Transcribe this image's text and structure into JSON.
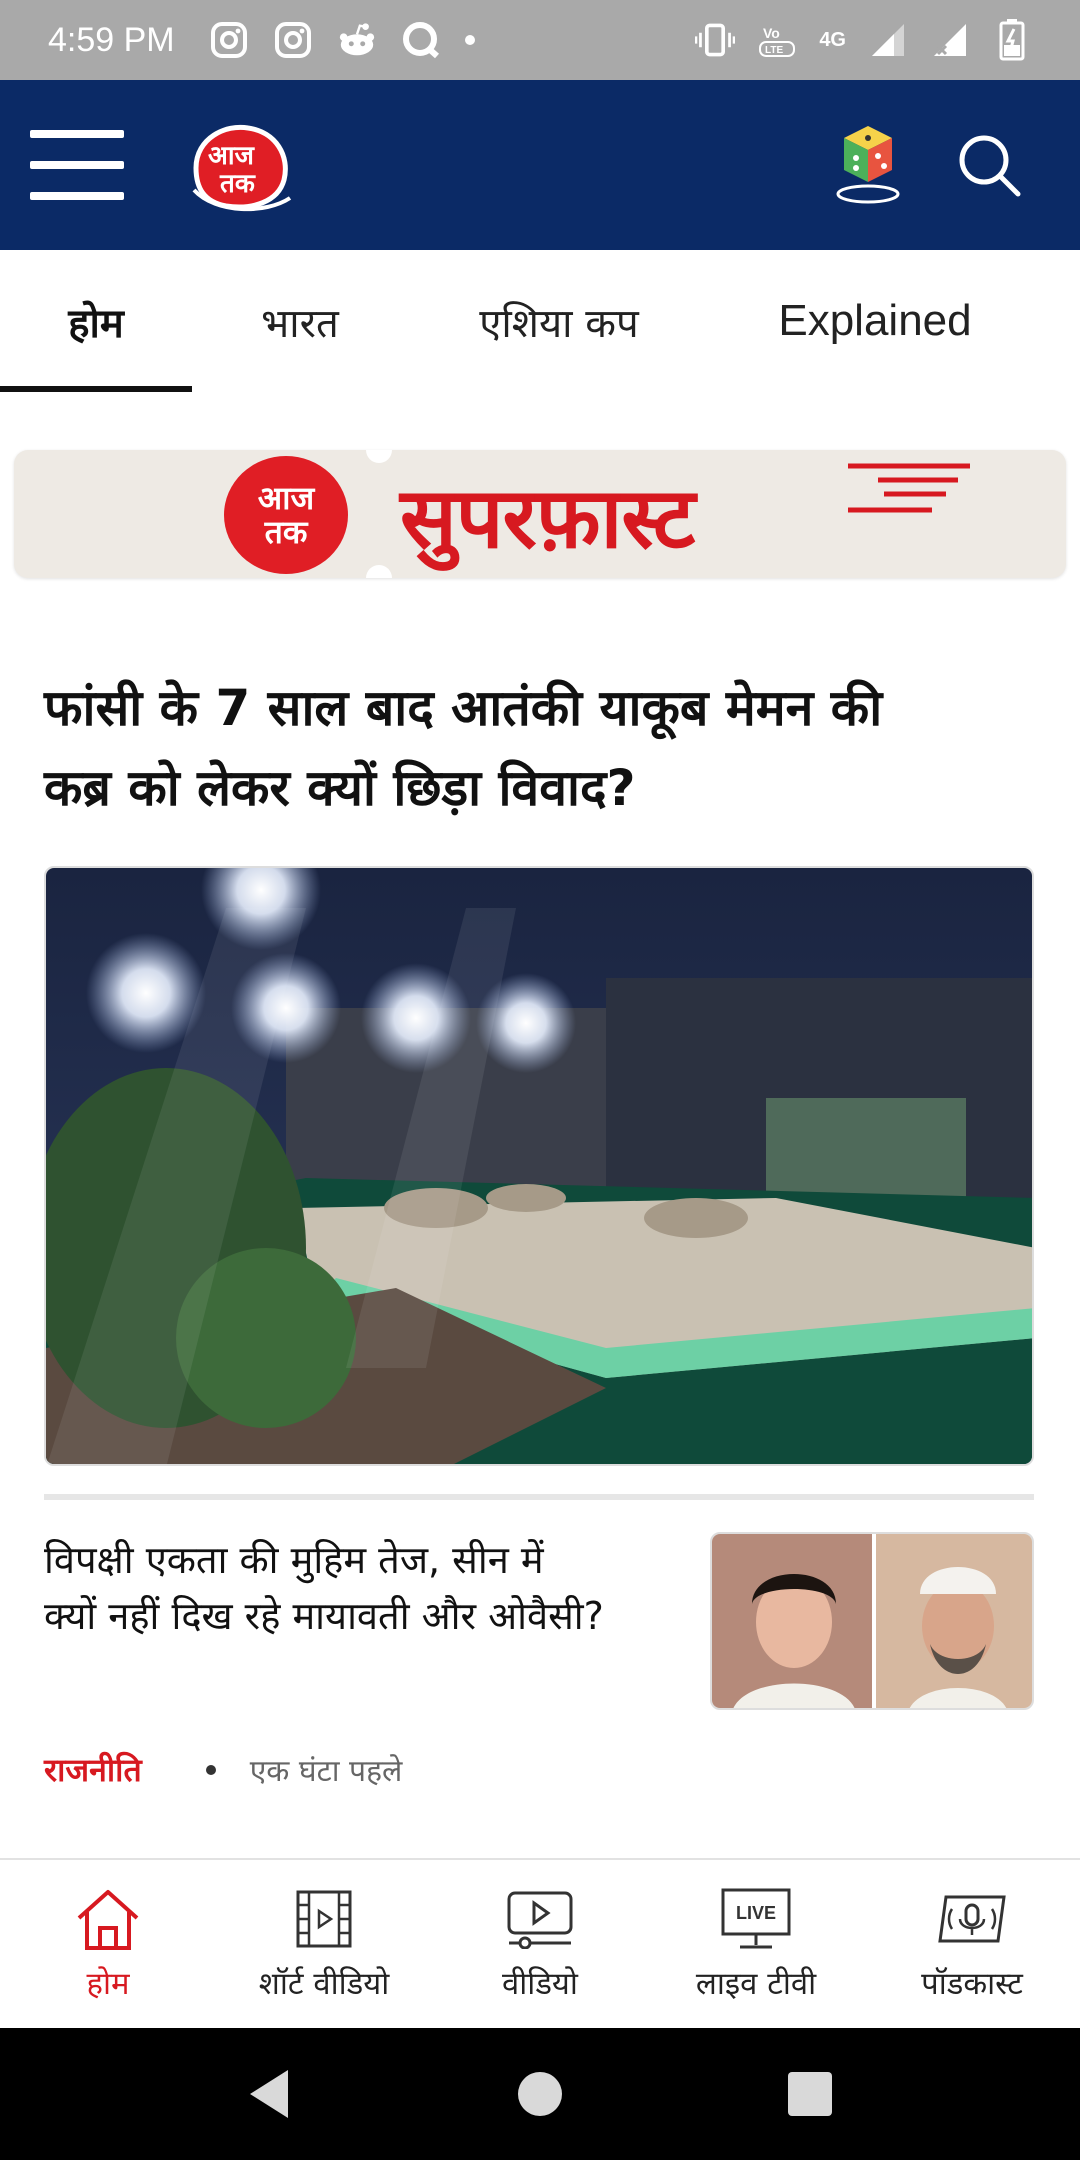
{
  "status_bar": {
    "time": "4:59 PM",
    "network_label": "4G",
    "icons_left": [
      "instagram-icon",
      "instagram-icon",
      "reddit-icon",
      "chat-icon",
      "dot-icon"
    ],
    "icons_right": [
      "vibrate-icon",
      "volte-icon",
      "signal-icon",
      "signal-icon",
      "battery-icon"
    ]
  },
  "header": {
    "logo_text": "आज तक",
    "brand_color": "#0b2a66",
    "accent_color": "#d71920"
  },
  "tabs": [
    {
      "label": "होम",
      "active": true
    },
    {
      "label": "भारत",
      "active": false
    },
    {
      "label": "एशिया कप",
      "active": false
    },
    {
      "label": "Explained",
      "active": false
    }
  ],
  "banner": {
    "logo_text": "आज तक",
    "title": "सुपरफ़ास्ट"
  },
  "lead_story": {
    "title": "फांसी के 7 साल बाद आतंकी याकूब मेमन की कब्र को लेकर क्यों छिड़ा विवाद?"
  },
  "story": {
    "title": "विपक्षी एकता की मुहिम तेज, सीन में क्यों नहीं दिख रहे मायावती और ओवैसी?",
    "category": "राजनीति",
    "time": "एक घंटा पहले"
  },
  "bottom_nav": [
    {
      "label": "होम",
      "icon": "home-icon",
      "active": true
    },
    {
      "label": "शॉर्ट वीडियो",
      "icon": "short-video-icon",
      "active": false
    },
    {
      "label": "वीडियो",
      "icon": "video-icon",
      "active": false
    },
    {
      "label": "लाइव टीवी",
      "icon": "live-tv-icon",
      "icon_text": "LIVE",
      "active": false
    },
    {
      "label": "पॉडकास्ट",
      "icon": "podcast-icon",
      "active": false
    }
  ]
}
